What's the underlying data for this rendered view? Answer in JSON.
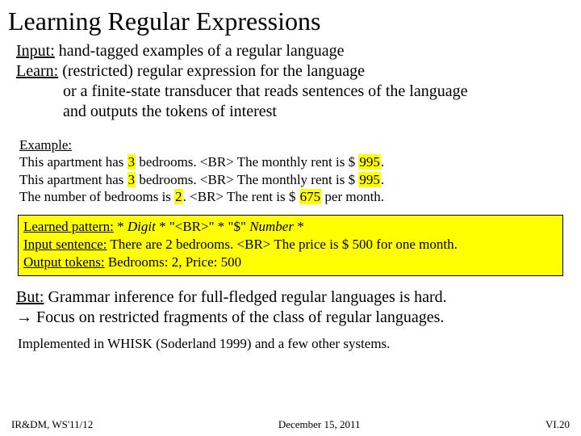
{
  "title": "Learning Regular Expressions",
  "intro": {
    "input_label": "Input:",
    "input_text": " hand-tagged examples of a regular language",
    "learn_label": "Learn:",
    "learn_text": " (restricted) regular expression for the language",
    "line3": "or a finite-state transducer that reads sentences of the language",
    "line4": "and outputs the tokens of interest"
  },
  "example": {
    "label": "Example:",
    "s1a": "This apartment has ",
    "s1h1": "3",
    "s1b": " bedrooms. <BR> The monthly rent is $ ",
    "s1h2": "995",
    "s1c": ".",
    "s2a": "This apartment has ",
    "s2h1": "3",
    "s2b": " bedrooms. <BR> The monthly rent is $ ",
    "s2h2": "995",
    "s2c": ".",
    "s3a": "The number of bedrooms is ",
    "s3h1": "2",
    "s3b": ". <BR> The rent is $ ",
    "s3h2": "675",
    "s3c": " per month."
  },
  "box": {
    "pattern_label": "Learned pattern:",
    "p1": " *  ",
    "p_digit": "Digit",
    "p2": "  *  \"<BR>\"   *  \"$\"  ",
    "p_number": "Number",
    "p3": "  *",
    "sent_label": "Input sentence:",
    "sent_text": " There are 2 bedrooms. <BR> The price is $ 500 for one month.",
    "tok_label": "Output tokens:",
    "tok_text": " Bedrooms: 2, Price: 500"
  },
  "but": {
    "label": "But:",
    "text1": " Grammar inference for full-fledged regular languages is hard.",
    "arrow": "→",
    "text2": " Focus on restricted fragments of the class of regular languages."
  },
  "impl": "Implemented in WHISK (Soderland 1999) and a few other systems.",
  "footer": {
    "left": "IR&DM, WS'11/12",
    "center": "December 15, 2011",
    "right": "VI.20"
  }
}
